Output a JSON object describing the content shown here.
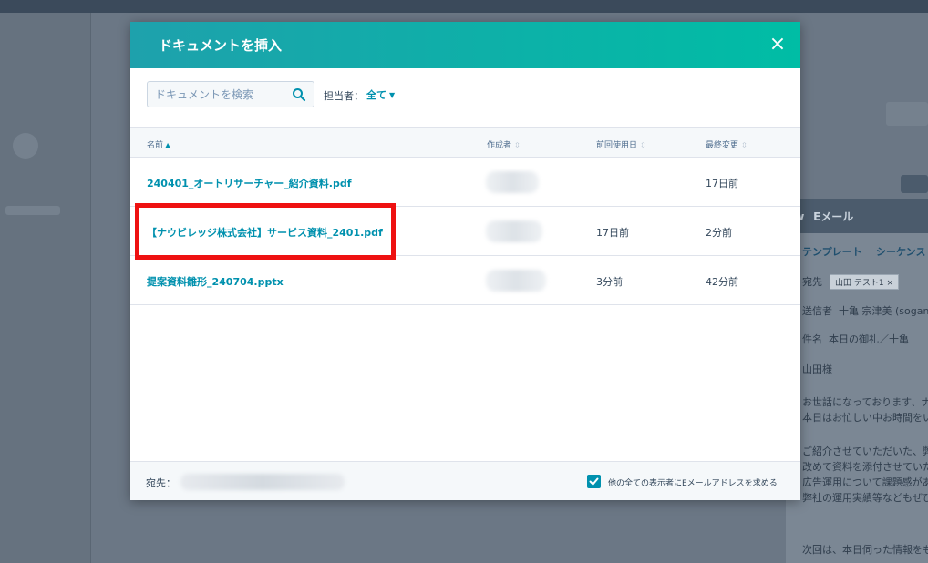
{
  "modal": {
    "title": "ドキュメントを挿入",
    "close_icon": "×"
  },
  "search": {
    "placeholder": "ドキュメントを検索",
    "value": ""
  },
  "owner_filter": {
    "label": "担当者：",
    "value": "全て"
  },
  "table": {
    "columns": [
      "名前",
      "作成者",
      "前回使用日",
      "最終変更"
    ],
    "rows": [
      {
        "name": "240401_オートリサーチャー_紹介資料.pdf",
        "creator": "",
        "last_used": "",
        "modified": "17日前"
      },
      {
        "name": "【ナウビレッジ株式会社】サービス資料_2401.pdf",
        "creator": "",
        "last_used": "17日前",
        "modified": "2分前"
      },
      {
        "name": "提案資料雛形_240704.pptx",
        "creator": "",
        "last_used": "3分前",
        "modified": "42分前"
      }
    ]
  },
  "footer": {
    "to_label": "宛先：",
    "to_value": "",
    "checkbox_checked": true,
    "checkbox_label": "他の全ての表示者にEメールアドレスを求める"
  },
  "background": {
    "panel_title": "Eメール",
    "tabs": [
      "テンプレート",
      "シーケンス"
    ],
    "to_label": "宛先",
    "to_chip": "山田 テスト1 ×",
    "from_label": "送信者",
    "from_value": "十亀 宗津美 (sogame",
    "subject_label": "件名",
    "subject_value": "本日の御礼／十亀",
    "body_lines": [
      "山田様",
      "お世話になっております、ナ",
      "本日はお忙しい中お時間をい",
      "ご紹介させていただいた、弊",
      "改めて資料を添付させていた",
      "広告運用について課題感があ",
      "弊社の運用実績等などもぜひ",
      "次回は、本日伺った情報をも"
    ]
  },
  "colors": {
    "header_gradient_start": "#1ea1ac",
    "header_gradient_end": "#00bda5",
    "link": "#0091ae",
    "highlight": "#ee1111"
  }
}
